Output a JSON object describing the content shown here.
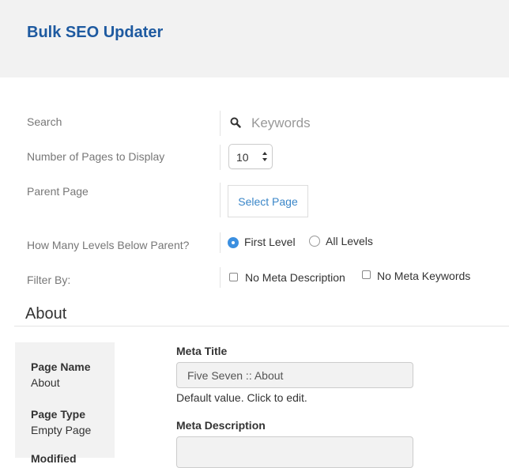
{
  "header": {
    "title": "Bulk SEO Updater"
  },
  "search": {
    "label": "Search",
    "placeholder": "Keywords",
    "icon": "search-icon"
  },
  "pages_to_display": {
    "label": "Number of Pages to Display",
    "value": "10"
  },
  "parent_page": {
    "label": "Parent Page",
    "button_label": "Select Page"
  },
  "levels": {
    "label": "How Many Levels Below Parent?",
    "options": [
      {
        "label": "First Level",
        "checked": true
      },
      {
        "label": "All Levels",
        "checked": false
      }
    ]
  },
  "filter": {
    "label": "Filter By:",
    "options": [
      {
        "label": "No Meta Description",
        "checked": false
      },
      {
        "label": "No Meta Keywords",
        "checked": false
      }
    ]
  },
  "section": {
    "title": "About"
  },
  "page_info": {
    "page_name_label": "Page Name",
    "page_name_value": "About",
    "page_type_label": "Page Type",
    "page_type_value": "Empty Page",
    "modified_label": "Modified"
  },
  "meta_title": {
    "label": "Meta Title",
    "value": "Five Seven :: About",
    "help": "Default value. Click to edit."
  },
  "meta_description": {
    "label": "Meta Description",
    "value": ""
  },
  "colors": {
    "accent": "#1e5aa0",
    "link": "#3a86c8",
    "radio": "#3b8fe0"
  }
}
